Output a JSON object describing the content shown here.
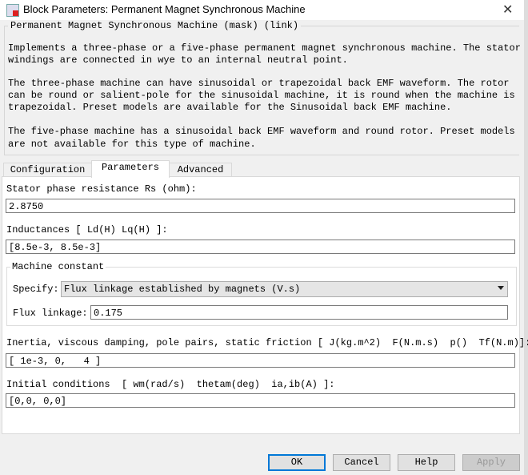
{
  "window": {
    "title": "Block Parameters: Permanent Magnet Synchronous Machine"
  },
  "description": {
    "legend": "Permanent Magnet Synchronous Machine (mask) (link)",
    "lines": [
      "Implements a three-phase or a five-phase permanent magnet synchronous machine. The stator",
      "windings are connected in wye to an internal neutral point.",
      "The three-phase machine can have sinusoidal or trapezoidal back EMF waveform. The rotor",
      "can be round or salient-pole for the sinusoidal machine, it is round when the machine is",
      "trapezoidal. Preset models are available for the Sinusoidal back EMF machine.",
      "The five-phase machine has a sinusoidal back EMF waveform and round rotor. Preset models",
      "are not available for this type of machine."
    ]
  },
  "tabs": [
    {
      "label": "Configuration"
    },
    {
      "label": "Parameters",
      "selected": true
    },
    {
      "label": "Advanced"
    }
  ],
  "params": {
    "rs_label": "Stator phase resistance Rs (ohm):",
    "rs_value": "2.8750",
    "ind_label": "Inductances [ Ld(H) Lq(H) ]:",
    "ind_value": "[8.5e-3, 8.5e-3]",
    "mc_legend": "Machine constant",
    "specify_label": "Specify:",
    "specify_value": "Flux linkage established by magnets (V.s)",
    "flux_label": "Flux linkage:",
    "flux_value": "0.175",
    "inertia_label": "Inertia, viscous damping, pole pairs, static friction [ J(kg.m^2)  F(N.m.s)  p()  Tf(N.m)]:",
    "inertia_value": "[ 1e-3, 0,   4 ]",
    "init_label": "Initial conditions  [ wm(rad/s)  thetam(deg)  ia,ib(A) ]:",
    "init_value": "[0,0, 0,0]"
  },
  "buttons": {
    "ok": "OK",
    "cancel": "Cancel",
    "help": "Help",
    "apply": "Apply"
  },
  "colors": {
    "focus": "#0078d7"
  }
}
